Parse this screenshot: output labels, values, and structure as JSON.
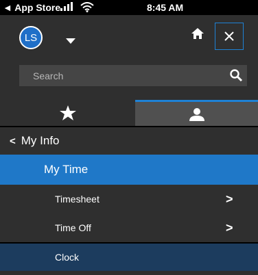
{
  "status_bar": {
    "back_label": "◄ App Store",
    "time": "8:45 AM"
  },
  "header": {
    "avatar_initials": "LS",
    "close_glyph": "✕"
  },
  "search": {
    "placeholder": "Search"
  },
  "tabs": [
    {
      "icon": "star-icon",
      "active": false
    },
    {
      "icon": "person-icon",
      "active": true
    }
  ],
  "menu": {
    "section_title": "My Info",
    "section_chevron": "<",
    "active_item": "My Time",
    "items": [
      {
        "label": "Timesheet",
        "arrow": ">"
      },
      {
        "label": "Time Off",
        "arrow": ">"
      },
      {
        "label": "Clock"
      }
    ]
  },
  "colors": {
    "accent": "#1f78c8",
    "header_bg": "#2f2f2f",
    "selected_row": "#1c3c5e"
  }
}
